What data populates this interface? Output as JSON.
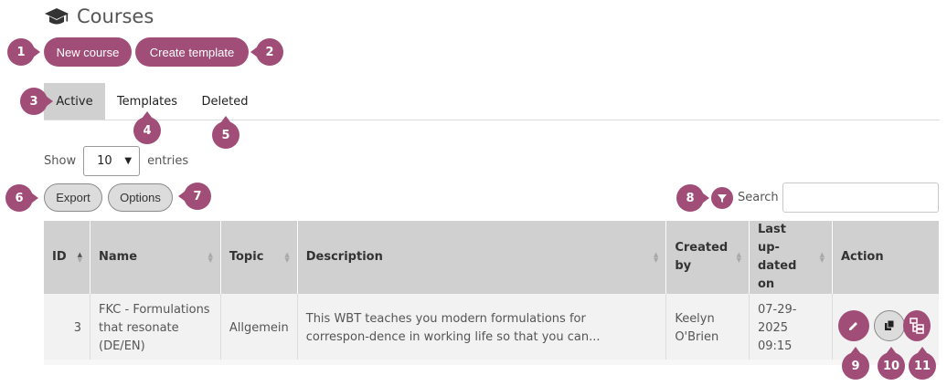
{
  "header": {
    "title": "Courses",
    "icon": "graduation-cap-icon"
  },
  "toolbar": {
    "new_course_label": "New course",
    "create_template_label": "Create template"
  },
  "tabs": [
    {
      "label": "Active",
      "active": true
    },
    {
      "label": "Templates",
      "active": false
    },
    {
      "label": "Deleted",
      "active": false
    }
  ],
  "entries": {
    "show_label": "Show",
    "selected": "10",
    "suffix_label": "entries"
  },
  "table_tools": {
    "export_label": "Export",
    "options_label": "Options",
    "search_label": "Search",
    "search_value": "",
    "filter_icon": "filter-icon"
  },
  "table": {
    "columns": [
      "ID",
      "Name",
      "Topic",
      "Description",
      "Created by",
      "Last up-dated on",
      "Action"
    ],
    "rows": [
      {
        "id": "3",
        "name": "FKC - Formulations that resonate (DE/EN)",
        "topic": "Allgemein",
        "description": "This WBT teaches you modern formulations for correspon-dence in working life so that you can...",
        "created_by": "Keelyn O'Brien",
        "updated": "07-29-2025 09:15"
      }
    ]
  },
  "markers": [
    "1",
    "2",
    "3",
    "4",
    "5",
    "6",
    "7",
    "8",
    "9",
    "10",
    "11"
  ],
  "colors": {
    "accent": "#a04e78",
    "header_bg": "#d0d0d0",
    "row_bg": "#f2f2f2",
    "button_gray": "#dcdcdc"
  }
}
